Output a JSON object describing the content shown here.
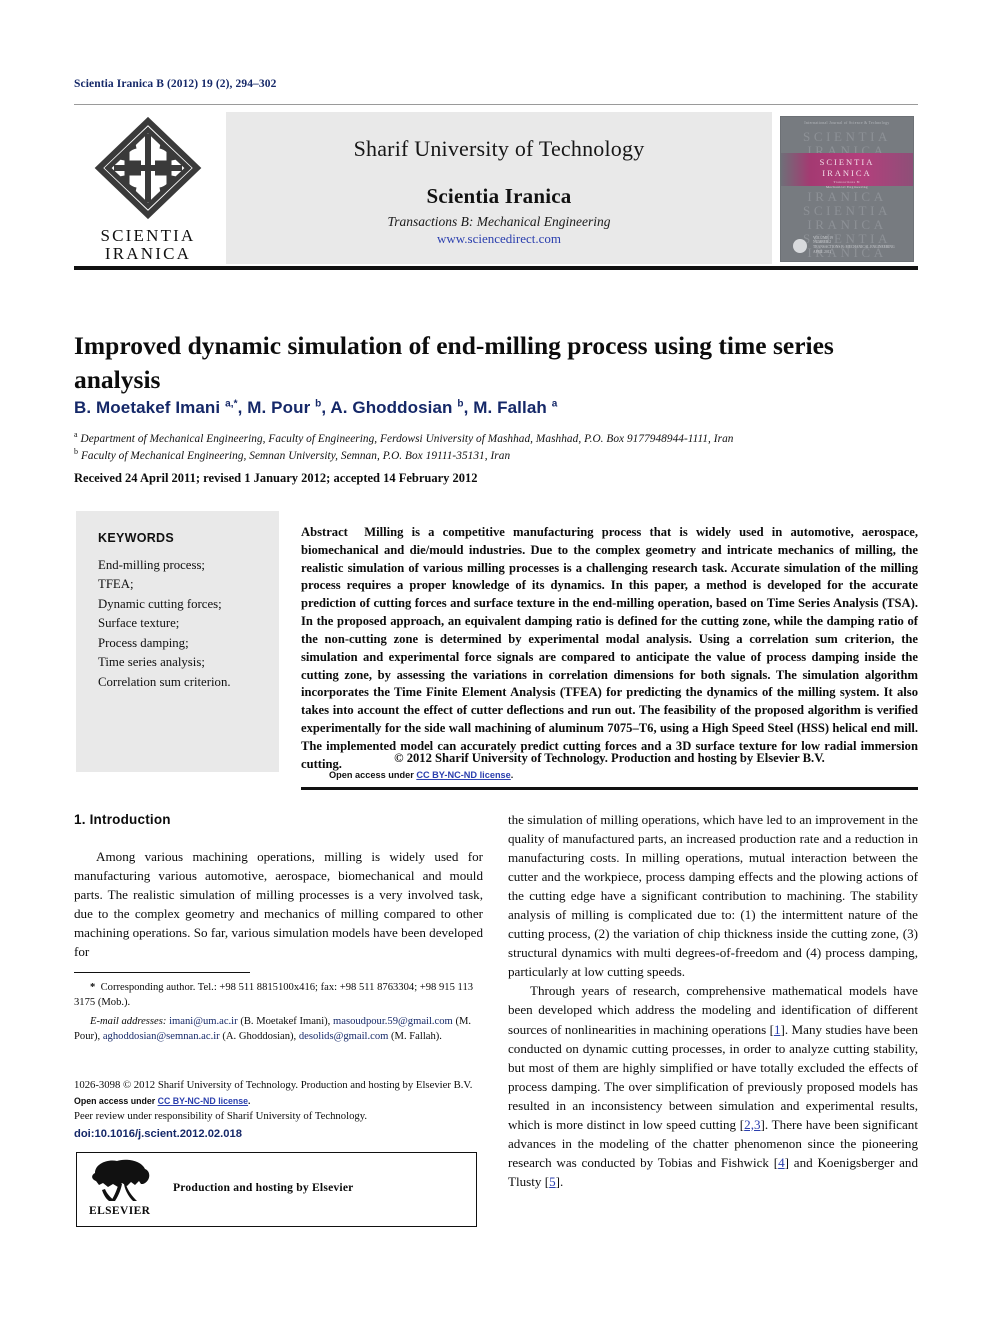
{
  "running_head": "Scientia Iranica B (2012) 19 (2), 294–302",
  "masthead": {
    "logo_line1": "SCIENTIA",
    "logo_line2": "IRANICA",
    "university": "Sharif University of Technology",
    "journal_title": "Scientia Iranica",
    "transactions": "Transactions B: Mechanical Engineering",
    "website": "www.sciencedirect.com",
    "cover": {
      "top_line": "International Journal of Science & Technology",
      "ghost_line1": "SCIENTIA",
      "ghost_line2": "IRANICA",
      "band_line1": "SCIENTIA",
      "band_line2": "IRANICA",
      "band_sub1": "Transactions B:",
      "band_sub2": "Mechanical Engineering",
      "volume_info1": "VOLUME 19",
      "volume_info2": "NUMBER 2",
      "volume_info3": "TRANSACTIONS B: MECHANICAL ENGINEERING",
      "volume_info4": "APRIL 2012"
    }
  },
  "article": {
    "title": "Improved dynamic simulation of end-milling process using time series analysis",
    "authors_html": "B. Moetakef Imani <sup>a,*</sup>, M. Pour <sup>b</sup>, A. Ghoddosian <sup>b</sup>, M. Fallah <sup>a</sup>",
    "affiliation_a": "Department of Mechanical Engineering, Faculty of Engineering, Ferdowsi University of Mashhad, Mashhad, P.O. Box 9177948944-1111, Iran",
    "affiliation_b": "Faculty of Mechanical Engineering, Semnan University, Semnan, P.O. Box 19111-35131, Iran",
    "dates": "Received 24 April 2011; revised 1 January 2012; accepted 14 February 2012"
  },
  "keywords": {
    "heading": "KEYWORDS",
    "items": [
      "End-milling process;",
      "TFEA;",
      "Dynamic cutting forces;",
      "Surface texture;",
      "Process damping;",
      "Time series analysis;",
      "Correlation sum criterion."
    ]
  },
  "abstract": {
    "label": "Abstract",
    "text": "Milling is a competitive manufacturing process that is widely used in automotive, aerospace, biomechanical and die/mould industries. Due to the complex geometry and intricate mechanics of milling, the realistic simulation of various milling processes is a challenging research task. Accurate simulation of the milling process requires a proper knowledge of its dynamics. In this paper, a method is developed for the accurate prediction of cutting forces and surface texture in the end-milling operation, based on Time Series Analysis (TSA). In the proposed approach, an equivalent damping ratio is defined for the cutting zone, while the damping ratio of the non-cutting zone is determined by experimental modal analysis. Using a correlation sum criterion, the simulation and experimental force signals are compared to anticipate the value of process damping inside the cutting zone, by assessing the variations in correlation dimensions for both signals. The simulation algorithm incorporates the Time Finite Element Analysis (TFEA) for predicting the dynamics of the milling system. It also takes into account the effect of cutter deflections and run out. The feasibility of the proposed algorithm is verified experimentally for the side wall machining of aluminum 7075–T6, using a High Speed Steel (HSS) helical end mill. The implemented model can accurately predict cutting forces and a 3D surface texture for low radial immersion cutting.",
    "copyright": "© 2012 Sharif University of Technology. Production and hosting by Elsevier B.V.",
    "open_access_prefix": "Open access under ",
    "open_access_license": "CC BY-NC-ND license",
    "open_access_suffix": "."
  },
  "body": {
    "section_heading": "1. Introduction",
    "left_paragraph_1": "Among various machining operations, milling is widely used for manufacturing various automotive, aerospace, biomechanical and mould parts. The realistic simulation of milling processes is a very involved task, due to the complex geometry and mechanics of milling compared to other machining operations. So far, various simulation models have been developed for",
    "right_paragraph_1": "the simulation of milling operations, which have led to an improvement in the quality of manufactured parts, an increased production rate and a reduction in manufacturing costs. In milling operations, mutual interaction between the cutter and the workpiece, process damping effects and the plowing actions of the cutting edge have a significant contribution to machining. The stability analysis of milling is complicated due to: (1) the intermittent nature of the cutting process, (2) the variation of chip thickness inside the cutting zone, (3) structural dynamics with multi degrees-of-freedom and (4) process damping, particularly at low cutting speeds.",
    "right_paragraph_2_part1": "Through years of research, comprehensive mathematical models have been developed which address the modeling and identification of different sources of nonlinearities in machining operations [",
    "right_ref_1": "1",
    "right_paragraph_2_part2": "]. Many studies have been conducted on dynamic cutting processes, in order to analyze cutting stability, but most of them are highly simplified or have totally excluded the effects of process damping. The over simplification of previously proposed models has resulted in an inconsistency between simulation and experimental results, which is more distinct in low speed cutting [",
    "right_ref_2": "2,3",
    "right_paragraph_2_part3": "]. There have been significant advances in the modeling of the chatter phenomenon since the pioneering research was conducted by Tobias and Fishwick [",
    "right_ref_3": "4",
    "right_paragraph_2_part4": "] and Koenigsberger and Tlusty [",
    "right_ref_4": "5",
    "right_paragraph_2_part5": "]."
  },
  "footnote": {
    "corresponding": "Corresponding author. Tel.: +98 511 8815100x416; fax: +98 511 8763304; +98 915 113 3175 (Mob.).",
    "email_label": "E-mail addresses:",
    "email_1": "imani@um.ac.ir",
    "email_1_owner": "(B. Moetakef Imani),",
    "email_2": "masoudpour.59@gmail.com",
    "email_2_owner": "(M. Pour),",
    "email_3": "aghoddosian@semnan.ac.ir",
    "email_3_owner": "(A. Ghoddosian),",
    "email_4": "desolids@gmail.com",
    "email_4_owner": "(M. Fallah)."
  },
  "license": {
    "issn_line": "1026-3098 © 2012 Sharif University of Technology. Production and hosting by Elsevier B.V.",
    "open_access_prefix": "Open access under ",
    "open_access_license": "CC BY-NC-ND license",
    "open_access_suffix": ".",
    "peer_review": "Peer review under responsibility of Sharif University of Technology.",
    "doi": "doi:10.1016/j.scient.2012.02.018"
  },
  "elsevier_box": {
    "wordmark": "ELSEVIER",
    "caption": "Production and hosting by Elsevier"
  },
  "colors": {
    "heading_blue": "#152868",
    "link_blue": "#2b3fae",
    "panel_gray": "#e9e9e9",
    "cover_gray": "#777b80",
    "cover_magenta": "#b33f7c"
  }
}
